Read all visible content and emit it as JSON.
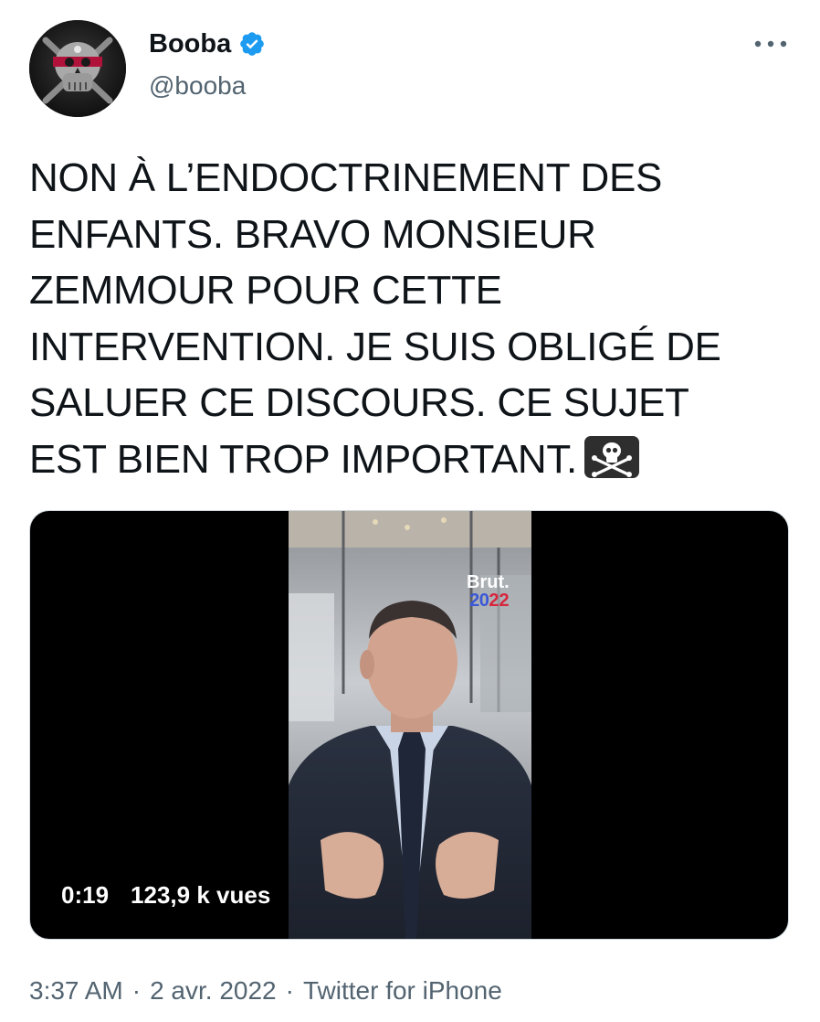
{
  "author": {
    "display_name": "Booba",
    "handle": "@booba",
    "verified": true
  },
  "tweet": {
    "text": "NON À L’ENDOCTRINEMENT DES\nENFANTS. BRAVO MONSIEUR\nZEMMOUR POUR CETTE\nINTERVENTION. JE SUIS OBLIGÉ DE\nSALUER CE DISCOURS. CE SUJET\nEST BIEN TROP IMPORTANT.",
    "trailing_emoji": "skull-and-crossbones"
  },
  "media": {
    "duration": "0:19",
    "views": "123,9 k vues",
    "watermark_brand": "Brut.",
    "watermark_year_a": "20",
    "watermark_year_b": "22"
  },
  "footer": {
    "time": "3:37 AM",
    "sep1": "·",
    "date": "2 avr. 2022",
    "sep2": "·",
    "source": "Twitter for iPhone"
  },
  "colors": {
    "verified_badge": "#1d9bf0",
    "secondary_text": "#536471",
    "primary_text": "#0f1419"
  }
}
